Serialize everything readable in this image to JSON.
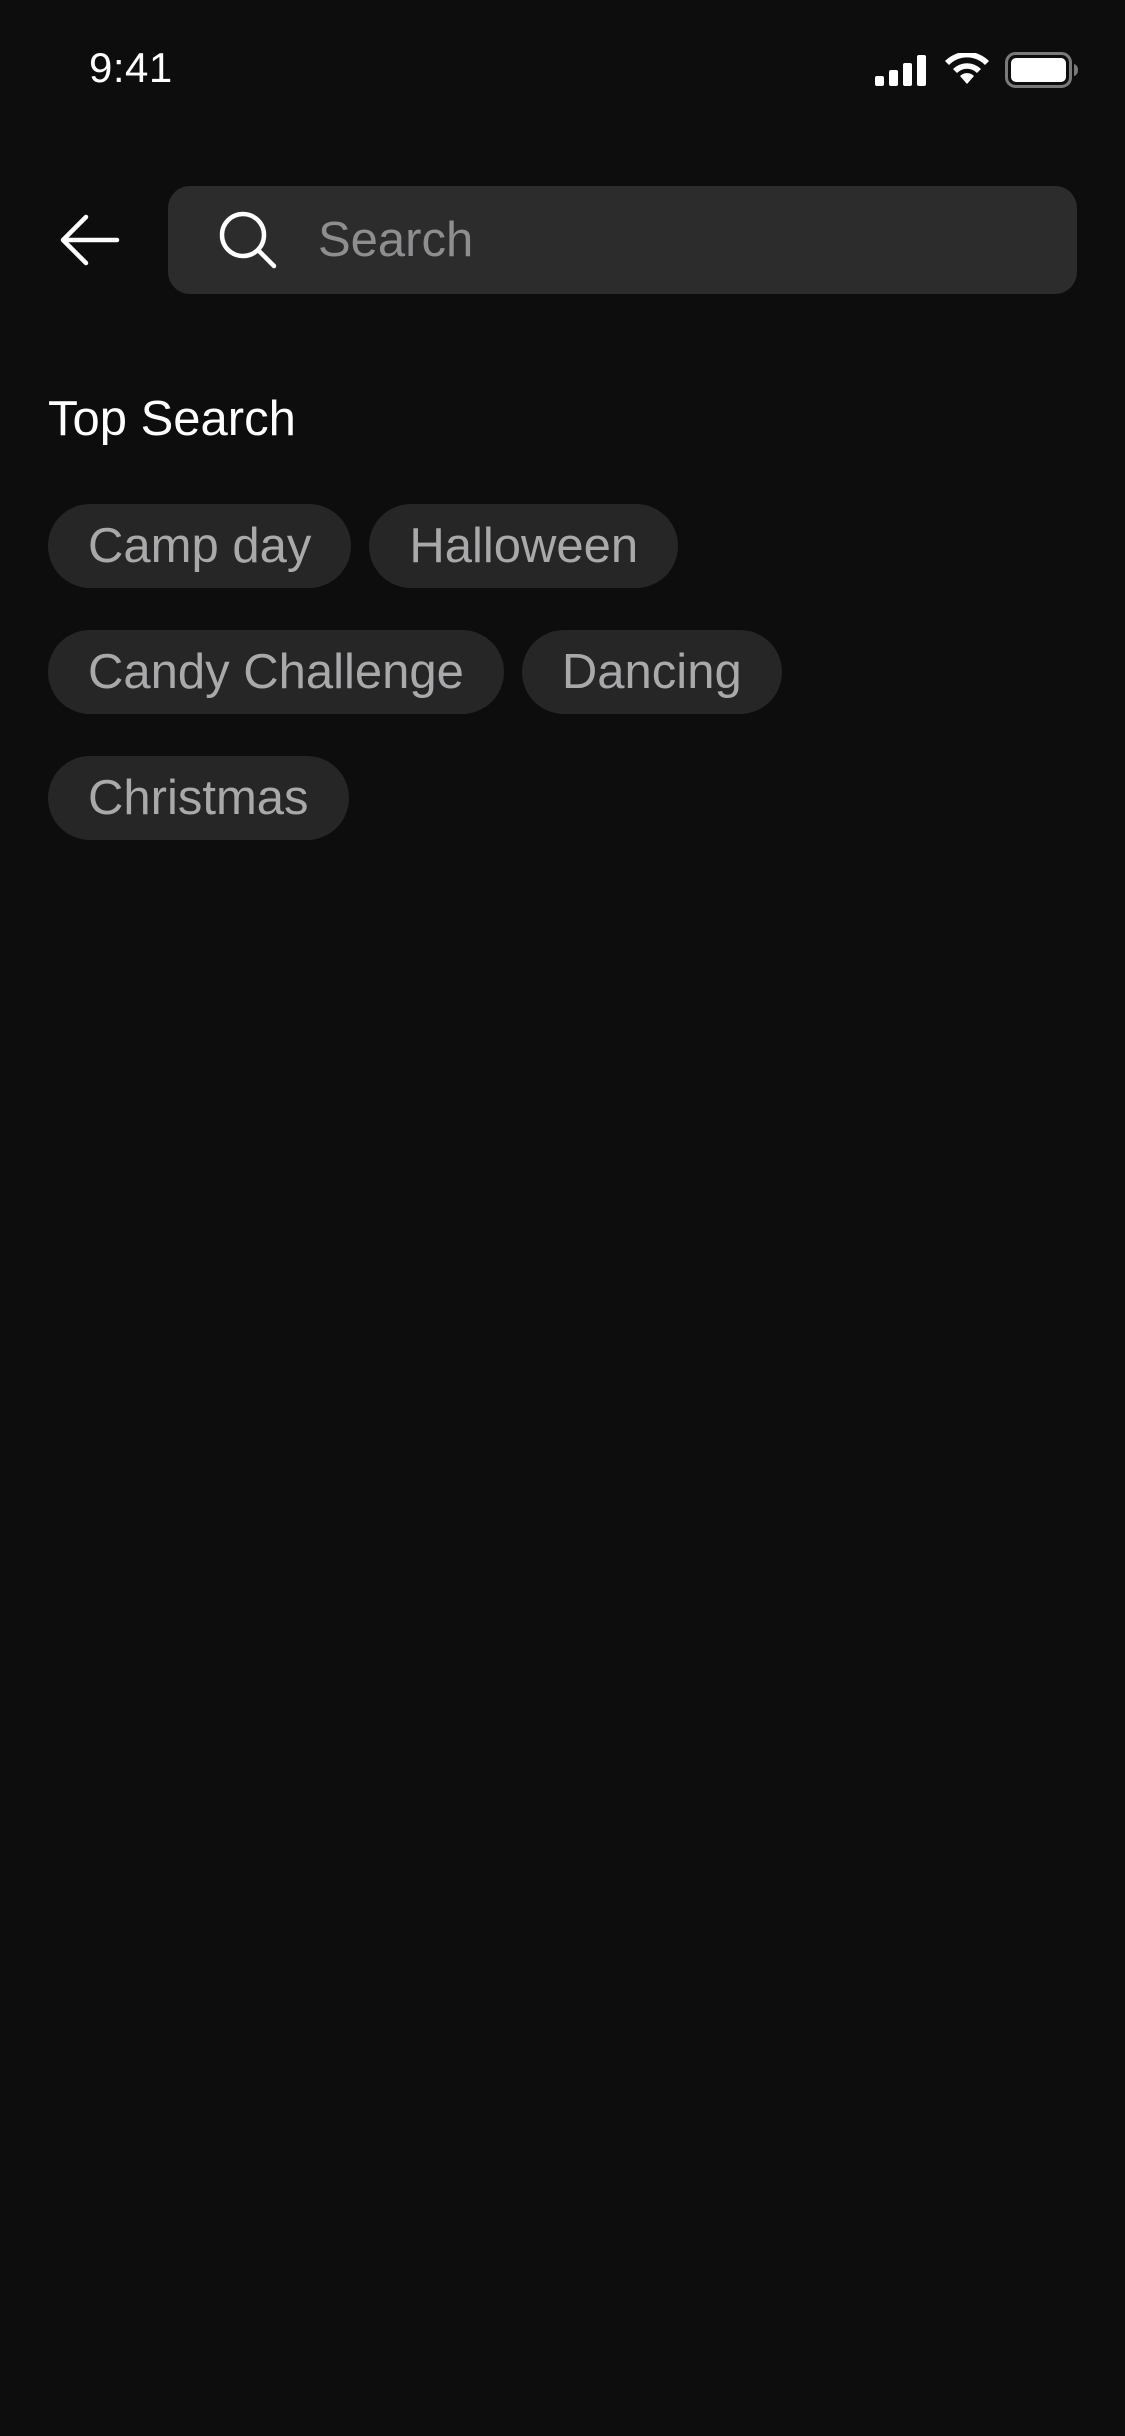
{
  "status_bar": {
    "time": "9:41",
    "icons": [
      "cellular-signal-icon",
      "wifi-icon",
      "battery-icon"
    ]
  },
  "search": {
    "placeholder": "Search",
    "back_icon": "arrow-left-icon",
    "search_icon": "search-icon"
  },
  "top_search": {
    "title": "Top Search",
    "rows": [
      [
        "Camp day",
        "Halloween"
      ],
      [
        "Candy Challenge",
        "Dancing"
      ],
      [
        "Christmas"
      ]
    ]
  },
  "colors": {
    "background": "#0d0d0e",
    "search_box": "#2c2c2d",
    "chip_background": "#262627",
    "chip_text": "#a9a9ab",
    "placeholder_text": "#8e8e90"
  }
}
